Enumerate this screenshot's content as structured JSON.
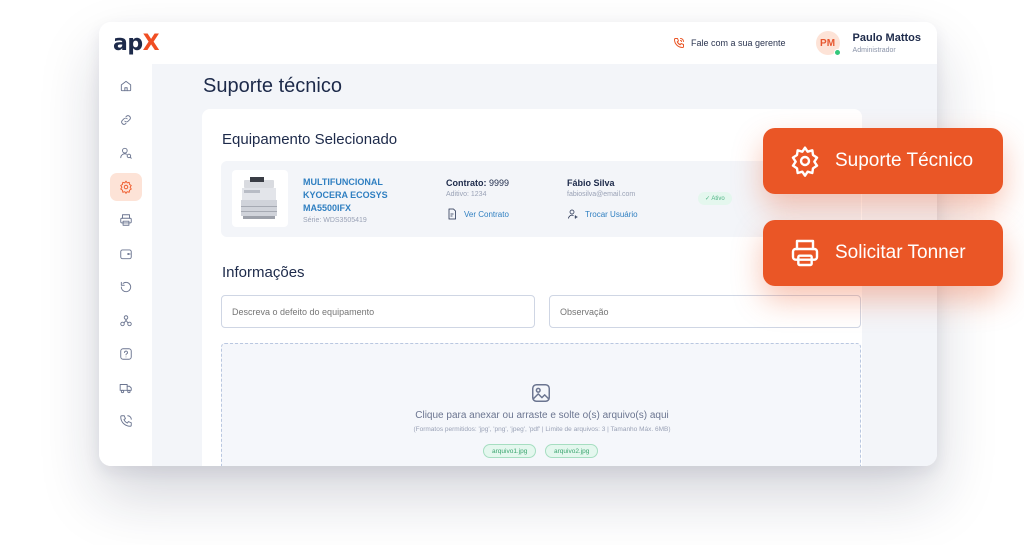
{
  "app": {
    "logo_main": "ap",
    "logo_accent": "X"
  },
  "header": {
    "contact_label": "Fale com a sua gerente",
    "avatar_initials": "PM",
    "user_name": "Paulo Mattos",
    "user_role": "Administrador"
  },
  "sidebar": {
    "items": [
      {
        "icon": "home-icon"
      },
      {
        "icon": "link-icon"
      },
      {
        "icon": "user-search-icon"
      },
      {
        "icon": "gear-icon",
        "active": true
      },
      {
        "icon": "printer-icon"
      },
      {
        "icon": "wallet-icon"
      },
      {
        "icon": "refresh-icon"
      },
      {
        "icon": "network-icon"
      },
      {
        "icon": "help-icon"
      },
      {
        "icon": "truck-icon"
      },
      {
        "icon": "phone-icon"
      }
    ]
  },
  "page": {
    "title": "Suporte técnico"
  },
  "equipment": {
    "section_title": "Equipamento Selecionado",
    "product_name": "MULTIFUNCIONAL KYOCERA ECOSYS MA5500IFX",
    "serial": "Série: WDS3505419",
    "contract_label": "Contrato:",
    "contract_number": "9999",
    "aditivo": "Aditivo: 1234",
    "view_contract_link": "Ver Contrato",
    "user_name": "Fábio Silva",
    "user_email": "fabiosilva@email.com",
    "switch_user_link": "Trocar Usuário",
    "status_badge": "✓ Ativo"
  },
  "info": {
    "section_title": "Informações",
    "defect_placeholder": "Descreva o defeito do equipamento",
    "observation_placeholder": "Observação"
  },
  "upload": {
    "title": "Clique para anexar ou arraste e solte o(s) arquivo(s) aqui",
    "subtitle": "(Formatos permitidos: 'jpg', 'png', 'jpeg', 'pdf' | Limite de arquivos: 3 | Tamanho Máx. 6MB)",
    "files": [
      "arquivo1.jpg",
      "arquivo2.jpg"
    ]
  },
  "actions": {
    "support_label": "Suporte Técnico",
    "toner_label": "Solicitar Tonner"
  },
  "colors": {
    "accent": "#ea5626",
    "link": "#2f7fc1",
    "success": "#34c77b",
    "text": "#1d2a4a"
  }
}
